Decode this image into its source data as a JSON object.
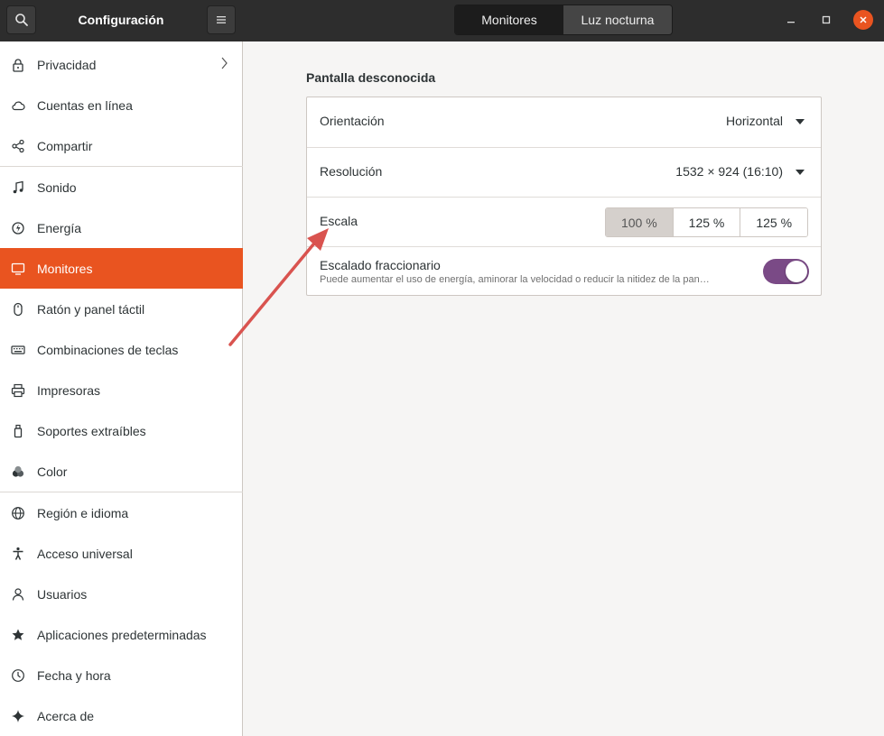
{
  "header": {
    "title": "Configuración",
    "tabs": [
      {
        "label": "Monitores",
        "active": true
      },
      {
        "label": "Luz nocturna",
        "active": false
      }
    ],
    "window_controls": [
      "minimize-icon",
      "maximize-icon",
      "close-icon"
    ]
  },
  "sidebar": {
    "items": [
      {
        "label": "Privacidad",
        "icon": "lock-icon"
      },
      {
        "label": "Cuentas en línea",
        "icon": "cloud-icon"
      },
      {
        "label": "Compartir",
        "icon": "share-icon"
      },
      {
        "label": "Sonido",
        "icon": "music-note-icon"
      },
      {
        "label": "Energía",
        "icon": "power-icon"
      },
      {
        "label": "Monitores",
        "icon": "display-icon",
        "selected": true
      },
      {
        "label": "Ratón y panel táctil",
        "icon": "mouse-icon"
      },
      {
        "label": "Combinaciones de teclas",
        "icon": "keyboard-icon"
      },
      {
        "label": "Impresoras",
        "icon": "printer-icon"
      },
      {
        "label": "Soportes extraíbles",
        "icon": "usb-drive-icon"
      },
      {
        "label": "Color",
        "icon": "color-icon"
      },
      {
        "label": "Región e idioma",
        "icon": "globe-icon"
      },
      {
        "label": "Acceso universal",
        "icon": "accessibility-icon"
      },
      {
        "label": "Usuarios",
        "icon": "user-icon"
      },
      {
        "label": "Aplicaciones predeterminadas",
        "icon": "star-icon"
      },
      {
        "label": "Fecha y hora",
        "icon": "clock-icon"
      },
      {
        "label": "Acerca de",
        "icon": "sparkle-icon"
      }
    ]
  },
  "display": {
    "section_title": "Pantalla desconocida",
    "orientation": {
      "label": "Orientación",
      "value": "Horizontal"
    },
    "resolution": {
      "label": "Resolución",
      "value": "1532 × 924 (16:10)"
    },
    "scale": {
      "label": "Escala",
      "options": [
        "100 %",
        "125 %",
        "125 %"
      ],
      "selected_index": 0
    },
    "fractional": {
      "label": "Escalado fraccionario",
      "description": "Puede aumentar el uso de energía, aminorar la velocidad o reducir la nitidez de la pan…",
      "enabled": true
    }
  },
  "colors": {
    "accent": "#e95420",
    "toggle_on": "#7a4a86",
    "annotation_arrow": "#d9534f"
  }
}
